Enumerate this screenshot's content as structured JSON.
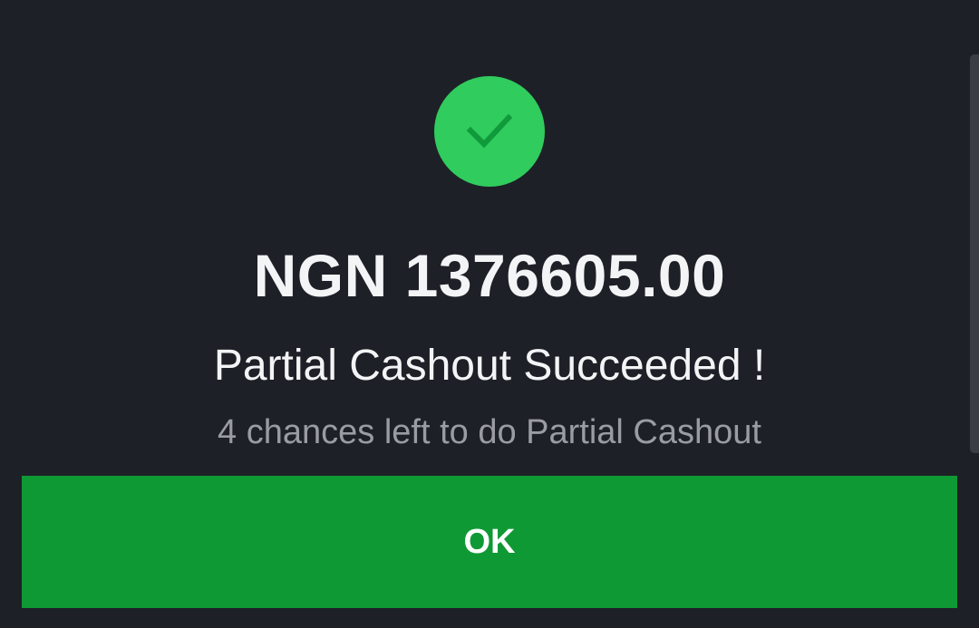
{
  "dialog": {
    "icon": "checkmark-icon",
    "amount": "NGN 1376605.00",
    "status_message": "Partial Cashout Succeeded !",
    "remaining_message": "4 chances left to do Partial Cashout",
    "ok_label": "OK"
  },
  "colors": {
    "background": "#1e2027",
    "success_circle": "#30cc5e",
    "checkmark": "#109a3b",
    "button": "#0f9934",
    "primary_text": "#f3f4f6",
    "secondary_text": "#9a9ca3"
  }
}
